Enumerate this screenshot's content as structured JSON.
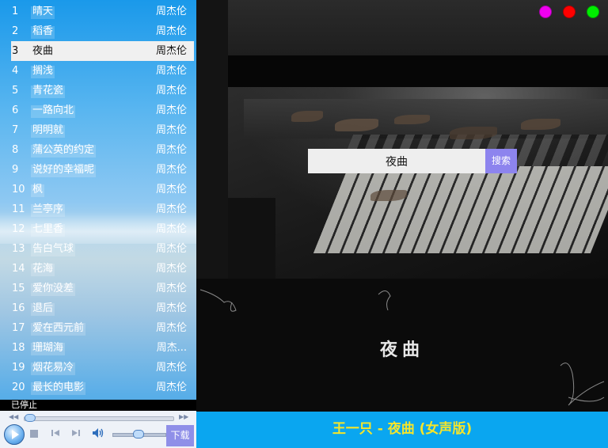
{
  "playlist": [
    {
      "num": "1",
      "title": "晴天",
      "artist": "周杰伦"
    },
    {
      "num": "2",
      "title": "稻香",
      "artist": "周杰伦"
    },
    {
      "num": "3",
      "title": "夜曲",
      "artist": "周杰伦"
    },
    {
      "num": "4",
      "title": "搁浅",
      "artist": "周杰伦"
    },
    {
      "num": "5",
      "title": "青花瓷",
      "artist": "周杰伦"
    },
    {
      "num": "6",
      "title": "一路向北",
      "artist": "周杰伦"
    },
    {
      "num": "7",
      "title": "明明就",
      "artist": "周杰伦"
    },
    {
      "num": "8",
      "title": "蒲公英的约定",
      "artist": "周杰伦"
    },
    {
      "num": "9",
      "title": "说好的幸福呢",
      "artist": "周杰伦"
    },
    {
      "num": "10",
      "title": "枫",
      "artist": "周杰伦"
    },
    {
      "num": "11",
      "title": "兰亭序",
      "artist": "周杰伦"
    },
    {
      "num": "12",
      "title": "七里香",
      "artist": "周杰伦"
    },
    {
      "num": "13",
      "title": "告白气球",
      "artist": "周杰伦"
    },
    {
      "num": "14",
      "title": "花海",
      "artist": "周杰伦"
    },
    {
      "num": "15",
      "title": "爱你没差",
      "artist": "周杰伦"
    },
    {
      "num": "16",
      "title": "退后",
      "artist": "周杰伦"
    },
    {
      "num": "17",
      "title": "爱在西元前",
      "artist": "周杰伦"
    },
    {
      "num": "18",
      "title": "珊瑚海",
      "artist": "周杰..."
    },
    {
      "num": "19",
      "title": "烟花易冷",
      "artist": "周杰伦"
    },
    {
      "num": "20",
      "title": "最长的电影",
      "artist": "周杰伦"
    }
  ],
  "selected_index": 2,
  "player": {
    "status": "已停止",
    "download_label": "下载",
    "seek_position": 0.03,
    "volume_level": 0.5
  },
  "search": {
    "value": "夜曲",
    "button_label": "搜索"
  },
  "cover": {
    "lyric_title": "夜曲"
  },
  "now_playing": "王一只 - 夜曲 (女声版)",
  "window_buttons": [
    {
      "name": "minimize",
      "color": "#ee00ee"
    },
    {
      "name": "close",
      "color": "#ff0000"
    },
    {
      "name": "maximize",
      "color": "#00ee00"
    }
  ],
  "colors": {
    "accent": "#0aa6f0",
    "now_playing_text": "#f5e52a",
    "search_button": "#8d84ee",
    "download_button": "#8f8fe8"
  }
}
